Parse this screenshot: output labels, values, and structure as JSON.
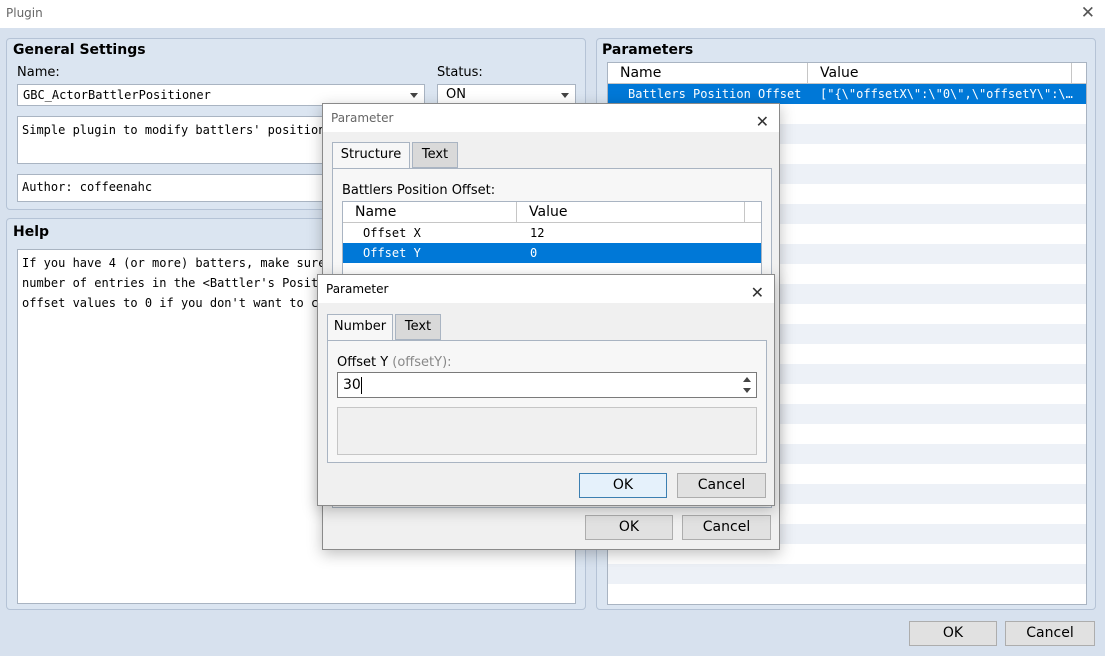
{
  "window": {
    "title": "Plugin",
    "close_glyph": "✕"
  },
  "general": {
    "heading": "General Settings",
    "name_label": "Name:",
    "name_value": "GBC_ActorBattlerPositioner",
    "status_label": "Status:",
    "status_value": "ON",
    "description": "Simple plugin to modify battlers' positions.",
    "author": "Author: coffeenahc"
  },
  "help": {
    "heading": "Help",
    "lines": [
      "If you have 4 (or more) batters, make sure y",
      "number of entries in the <Battler's Position",
      "offset values to 0 if you don't want to char"
    ]
  },
  "parameters": {
    "heading": "Parameters",
    "col_name": "Name",
    "col_value": "Value",
    "rows": [
      {
        "name": "Battlers Position Offset",
        "value": "[\"{\\\"offsetX\\\":\\\"0\\\",\\\"offsetY\\\":\\…"
      }
    ]
  },
  "dialog1": {
    "title": "Parameter",
    "tab_structure": "Structure",
    "tab_text": "Text",
    "label": "Battlers Position Offset:",
    "col_name": "Name",
    "col_value": "Value",
    "rows": [
      {
        "name": "Offset X",
        "value": "12"
      },
      {
        "name": "Offset Y",
        "value": "0"
      }
    ],
    "ok": "OK",
    "cancel": "Cancel"
  },
  "dialog2": {
    "title": "Parameter",
    "tab_number": "Number",
    "tab_text": "Text",
    "label": "Offset Y",
    "label_key": "(offsetY):",
    "value": "30",
    "ok": "OK",
    "cancel": "Cancel"
  },
  "footer": {
    "ok": "OK",
    "cancel": "Cancel"
  },
  "colors": {
    "selection": "#0078d7",
    "background": "#d7e1ee"
  }
}
